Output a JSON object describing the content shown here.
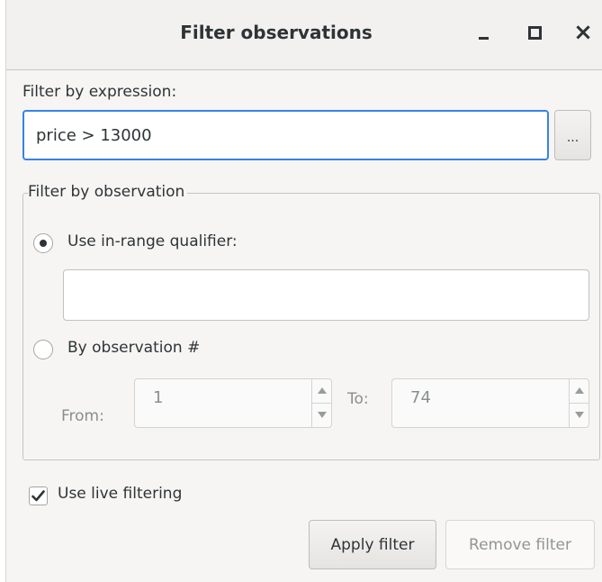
{
  "window": {
    "title": "Filter observations",
    "minimize_icon": "minimize-icon",
    "maximize_icon": "maximize-icon",
    "close_icon": "close-icon",
    "close_glyph": "×"
  },
  "expression": {
    "label": "Filter by expression:",
    "value": "price > 13000",
    "browse_label": "..."
  },
  "observation_group": {
    "title": "Filter by observation",
    "in_range_label": "Use in-range qualifier:",
    "in_range_selected": true,
    "in_range_value": "",
    "by_number_label": "By observation #",
    "by_number_selected": false,
    "from_label": "From:",
    "from_value": "1",
    "to_label": "To:",
    "to_value": "74"
  },
  "live_filtering": {
    "label": "Use live filtering",
    "checked": true
  },
  "buttons": {
    "apply": "Apply filter",
    "remove": "Remove filter"
  },
  "colors": {
    "focus": "#3584e4",
    "window_bg": "#f6f5f4"
  }
}
